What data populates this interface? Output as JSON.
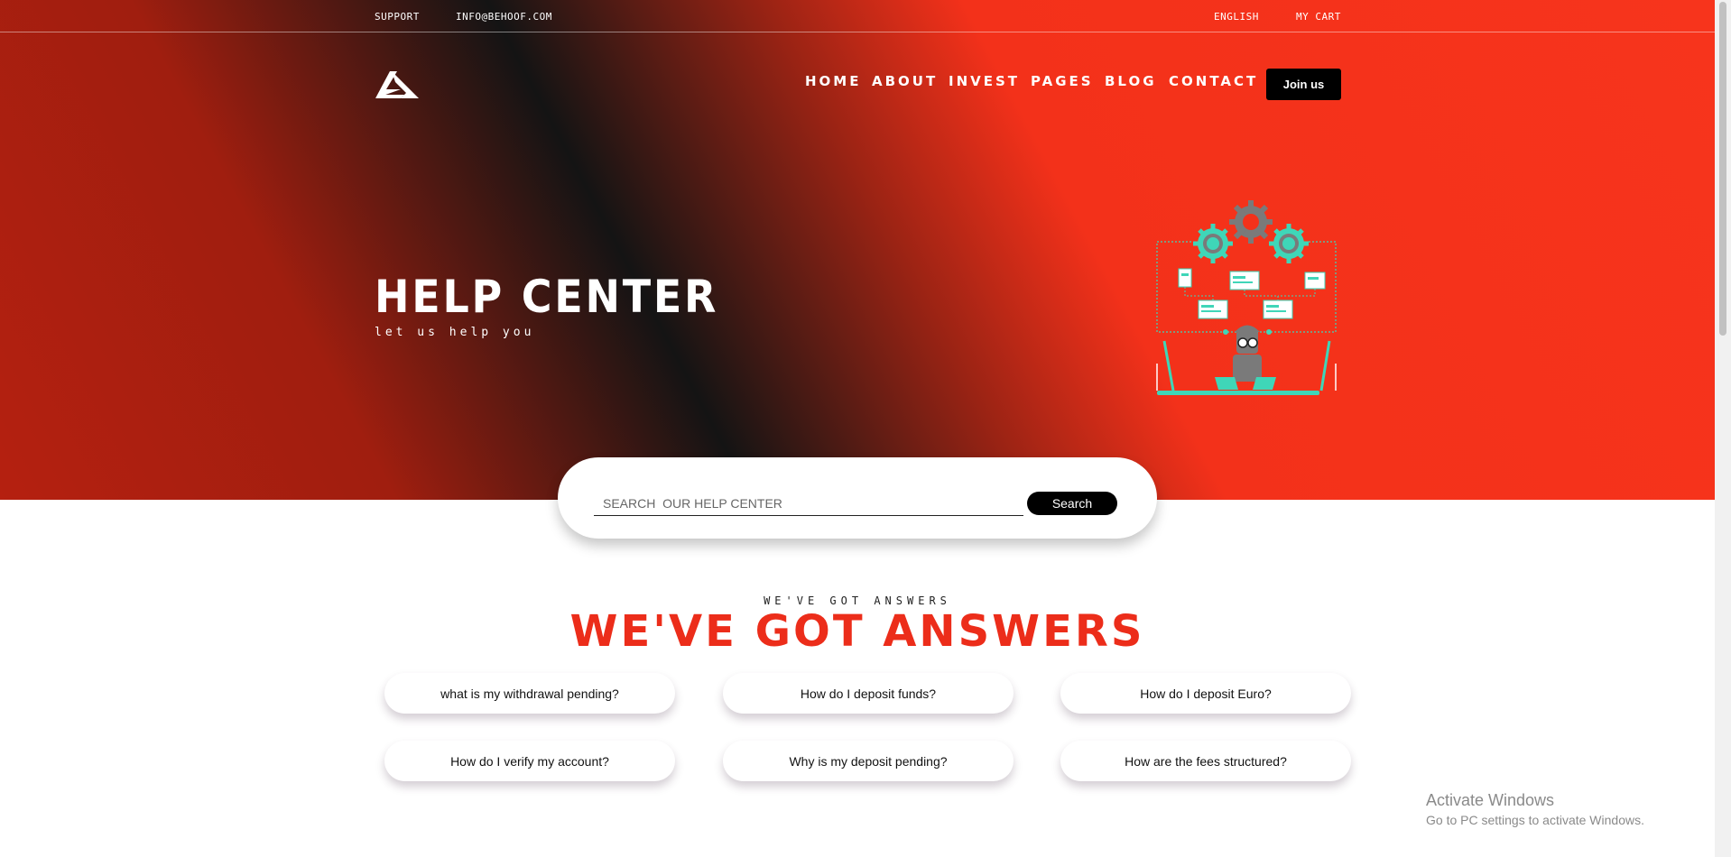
{
  "topbar": {
    "support": "SUPPORT",
    "email": "INFO@BEHOOF.COM",
    "language": "ENGLISH",
    "cart": "MY CART"
  },
  "nav": {
    "items": [
      "HOME",
      "ABOUT",
      "INVEST",
      "PAGES",
      "BLOG",
      "CONTACT"
    ],
    "join_label": "Join us"
  },
  "hero": {
    "title": "HELP CENTER",
    "subtitle": "let us help you"
  },
  "search": {
    "placeholder": "SEARCH  OUR HELP CENTER",
    "button_label": "Search"
  },
  "answers": {
    "eyebrow": "WE'VE GOT ANSWERS",
    "title": "WE'VE GOT ANSWERS",
    "questions": [
      "what is my withdrawal pending?",
      "How do I deposit funds?",
      "How do I deposit Euro?",
      "How do I verify my account?",
      "Why is my deposit pending?",
      "How are the fees structured?"
    ]
  },
  "watermark": {
    "line1": "Activate Windows",
    "line2": "Go to PC settings to activate Windows."
  },
  "colors": {
    "accent": "#ec2d1a",
    "hero_red": "#f7341c",
    "hero_dark": "#141414",
    "illustration_teal": "#3fd6b8"
  }
}
